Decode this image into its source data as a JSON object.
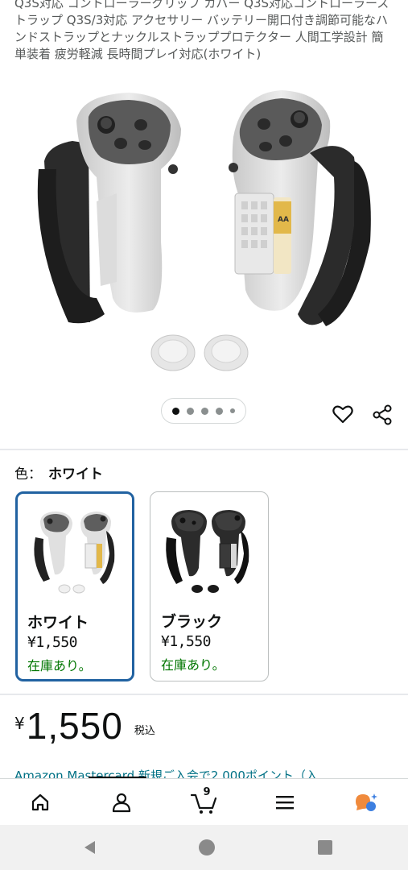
{
  "product": {
    "title": "Q3S対応 コントローラーグリップ カバー Q3S対応コントローラーストラップ Q3S/3対応 アクセサリー バッテリー開口付き調節可能なハンドストラップとナックルストラッププロテクター 人間工学設計 簡単装着 疲労軽減 長時間プレイ対応(ホワイト)"
  },
  "gallery": {
    "image_count": 5,
    "active_index": 0,
    "battery_label": "AA"
  },
  "actions": {
    "wishlist_icon": "heart-icon",
    "share_icon": "share-icon"
  },
  "variant": {
    "label": "色：",
    "selected": "ホワイト",
    "options": [
      {
        "name": "ホワイト",
        "price": "¥1,550",
        "stock": "在庫あり。",
        "selected": true
      },
      {
        "name": "ブラック",
        "price": "¥1,550",
        "stock": "在庫あり。",
        "selected": false
      }
    ]
  },
  "price": {
    "currency": "¥",
    "amount": "1,550",
    "tax_note": "税込"
  },
  "promo": {
    "text": "Amazon Mastercard 新規ご入会で2,000ポイント（入"
  },
  "bottom_nav": {
    "items": [
      "home-icon",
      "account-icon",
      "cart-icon",
      "menu-icon",
      "rufus-icon"
    ],
    "cart_count": "9"
  },
  "system_nav": [
    "back-icon",
    "home-circle-icon",
    "recents-icon"
  ],
  "colors": {
    "link": "#007185",
    "in_stock": "#007600",
    "selected_border": "#2162a1",
    "text": "#0f1111",
    "rufus_orange": "#f08a3c",
    "rufus_blue": "#3d7fe0"
  }
}
